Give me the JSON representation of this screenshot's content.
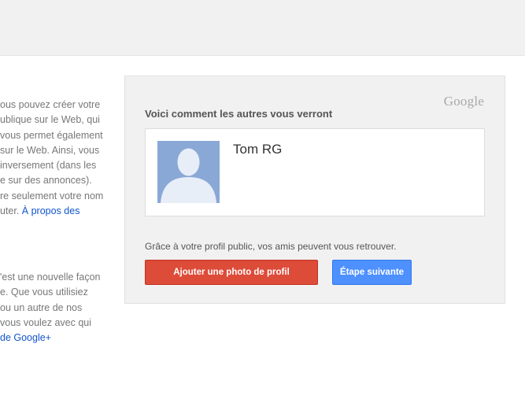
{
  "intro_paragraph": {
    "lines": [
      "ous pouvez créer votre",
      "ublique sur le Web, qui",
      "vous permet également",
      " sur le Web. Ainsi, vous",
      " inversement (dans les",
      "e sur des annonces).",
      "re seulement votre nom"
    ],
    "last_line_text": "uter. ",
    "link": "À propos des"
  },
  "second_paragraph": {
    "lines": [
      "'est une nouvelle façon",
      "e. Que vous utilisiez",
      " ou un autre de nos",
      " vous voulez avec qui"
    ],
    "link": "de Google+"
  },
  "card": {
    "logo": "Google",
    "title": "Voici comment les autres vous verront",
    "profile": {
      "name": "Tom RG",
      "avatar_icon": "default-avatar-icon"
    },
    "info_text": "Grâce à votre profil public, vos amis peuvent vous retrouver.",
    "buttons": {
      "add_photo": "Ajouter une photo de profil",
      "next_step": "Étape suivante"
    }
  },
  "colors": {
    "red_button": "#dd4b39",
    "blue_button": "#4d90fe",
    "link": "#1155cc",
    "avatar_bg": "#8aa8d6"
  }
}
